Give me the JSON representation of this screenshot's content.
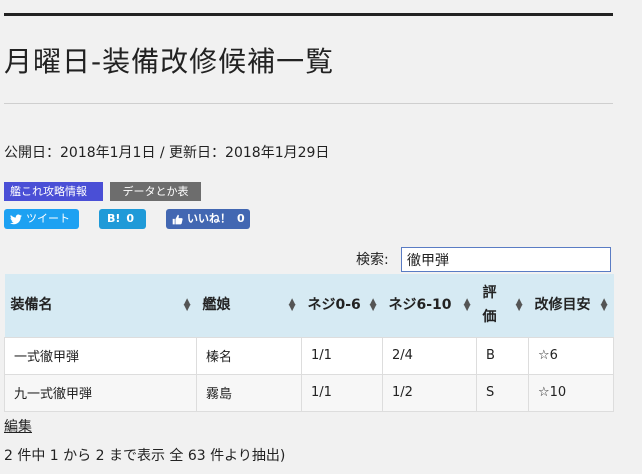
{
  "page": {
    "title": "月曜日-装備改修候補一覧",
    "dates": "公開日：2018年1月1日 / 更新日：2018年1月29日"
  },
  "tags": {
    "kancolle": "艦これ攻略情報",
    "data": "データとか表"
  },
  "share": {
    "twitter_label": "ツイート",
    "hatena_label": "B!",
    "hatena_count": "0",
    "facebook_label": "いいね！",
    "facebook_count": "0"
  },
  "search": {
    "label": "検索:",
    "value": "徹甲弾"
  },
  "table": {
    "headers": [
      "装備名",
      "艦娘",
      "ネジ0-6",
      "ネジ6-10",
      "評価",
      "改修目安"
    ],
    "rows": [
      [
        "一式徹甲弾",
        "榛名",
        "1/1",
        "2/4",
        "B",
        "☆6"
      ],
      [
        "九一式徹甲弾",
        "霧島",
        "1/1",
        "1/2",
        "S",
        "☆10"
      ]
    ]
  },
  "footer": {
    "edit_label": "編集",
    "info": "2 件中 1 から 2 まで表示 全 63 件より抽出)"
  },
  "colors": {
    "kancolle_tag": "#4a4fd6",
    "data_tag": "#6d6d6d",
    "twitter": "#1da1f2",
    "hatena": "#1f9ad8",
    "facebook": "#4267b2",
    "table_header": "#d6eaf3"
  }
}
